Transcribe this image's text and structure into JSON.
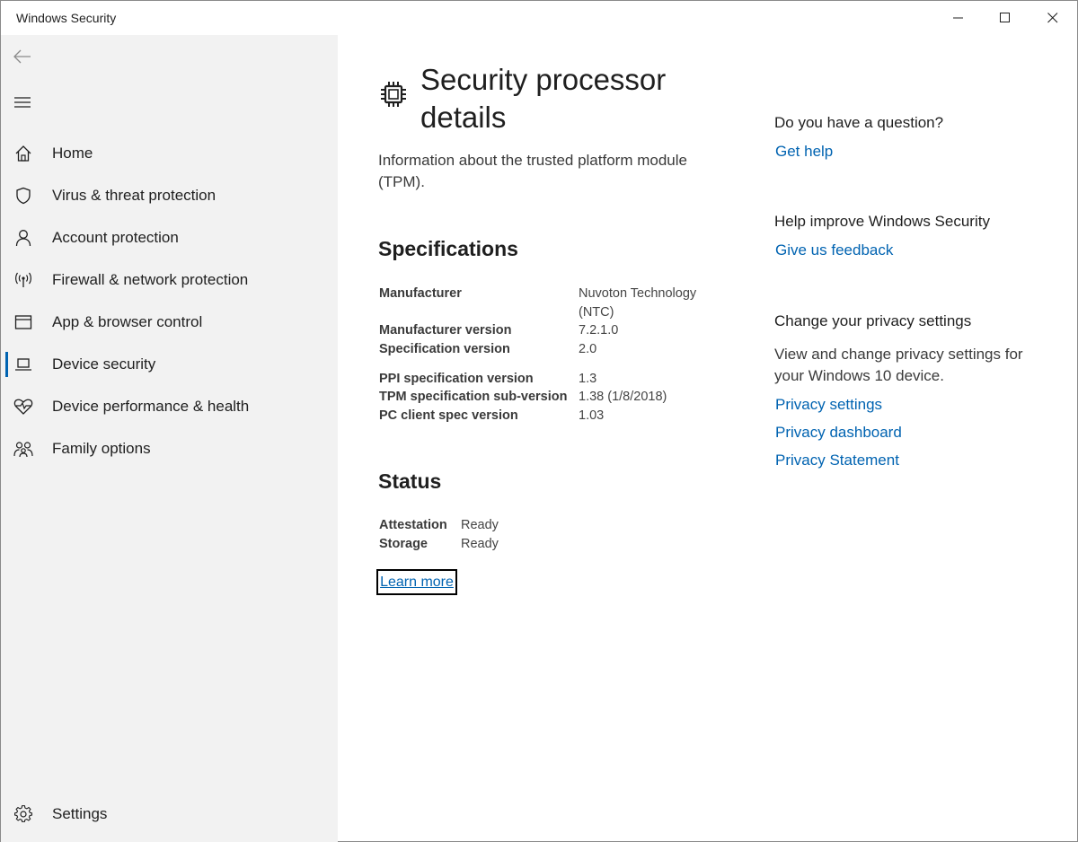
{
  "window": {
    "title": "Windows Security",
    "controls": [
      "minimize",
      "maximize",
      "close"
    ]
  },
  "sidebar": {
    "back_icon": "arrow-left-icon",
    "menu_icon": "hamburger-icon",
    "selected_item": "Device security",
    "items": [
      {
        "label": "Home",
        "icon": "home-icon"
      },
      {
        "label": "Virus & threat protection",
        "icon": "shield-icon"
      },
      {
        "label": "Account protection",
        "icon": "person-icon"
      },
      {
        "label": "Firewall & network protection",
        "icon": "antenna-icon"
      },
      {
        "label": "App & browser control",
        "icon": "browser-window-icon"
      },
      {
        "label": "Device security",
        "icon": "laptop-icon"
      },
      {
        "label": "Device performance & health",
        "icon": "heart-pulse-icon"
      },
      {
        "label": "Family options",
        "icon": "family-icon"
      }
    ],
    "settings": {
      "label": "Settings",
      "icon": "gear-icon"
    }
  },
  "main": {
    "title_icon": "chip-icon",
    "title": "Security processor details",
    "description": "Information about the trusted platform module (TPM).",
    "specifications": {
      "heading": "Specifications",
      "rows": [
        {
          "key": "Manufacturer",
          "value": "Nuvoton Technology (NTC)"
        },
        {
          "key": "Manufacturer version",
          "value": "7.2.1.0"
        },
        {
          "key": "Specification version",
          "value": "2.0"
        },
        {
          "key": "PPI specification version",
          "value": "1.3"
        },
        {
          "key": "TPM specification sub-version",
          "value": "1.38 (1/8/2018)"
        },
        {
          "key": "PC client spec version",
          "value": "1.03"
        }
      ]
    },
    "status": {
      "heading": "Status",
      "rows": [
        {
          "key": "Attestation",
          "value": "Ready"
        },
        {
          "key": "Storage",
          "value": "Ready"
        }
      ]
    },
    "learn_more": "Learn more"
  },
  "right": {
    "question": {
      "heading": "Do you have a question?",
      "link": "Get help"
    },
    "improve": {
      "heading": "Help improve Windows Security",
      "link": "Give us feedback"
    },
    "privacy": {
      "heading": "Change your privacy settings",
      "text": "View and change privacy settings for your Windows 10 device.",
      "links": [
        "Privacy settings",
        "Privacy dashboard",
        "Privacy Statement"
      ]
    }
  },
  "colors": {
    "accent": "#0063b1",
    "sidebar_bg": "#f2f2f2",
    "background": "#ffffff"
  }
}
